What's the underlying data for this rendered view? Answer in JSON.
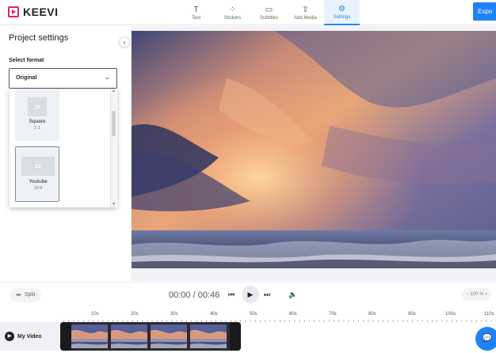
{
  "app": {
    "name": "KEEVI",
    "export_label": "Expo"
  },
  "toolbar": {
    "tabs": [
      {
        "label": "Text",
        "icon": "text-icon",
        "glyph": "T"
      },
      {
        "label": "Stickers",
        "icon": "stickers-icon",
        "glyph": "⁘"
      },
      {
        "label": "Subtitles",
        "icon": "subtitles-icon",
        "glyph": "▭"
      },
      {
        "label": "Add Media",
        "icon": "upload-icon",
        "glyph": "⇪"
      },
      {
        "label": "Settings",
        "icon": "gear-icon",
        "glyph": "⚙",
        "active": true
      }
    ]
  },
  "sidebar": {
    "title": "Project settings",
    "select_label": "Select format",
    "selected_format": "Original",
    "formats": [
      {
        "name": "Square",
        "ratio": "1:1"
      },
      {
        "name": "Youtube",
        "ratio": "16:9",
        "selected": true
      }
    ]
  },
  "player": {
    "split_label": "Split",
    "time": "00:00 / 00:46",
    "zoom": "100 %"
  },
  "timeline": {
    "ticks": [
      "10s",
      "20s",
      "30s",
      "40s",
      "50s",
      "60s",
      "70s",
      "80s",
      "90s",
      "100s",
      "110s"
    ],
    "track_label": "My Video"
  },
  "colors": {
    "accent": "#1e83f7",
    "brand": "#e0245e"
  }
}
